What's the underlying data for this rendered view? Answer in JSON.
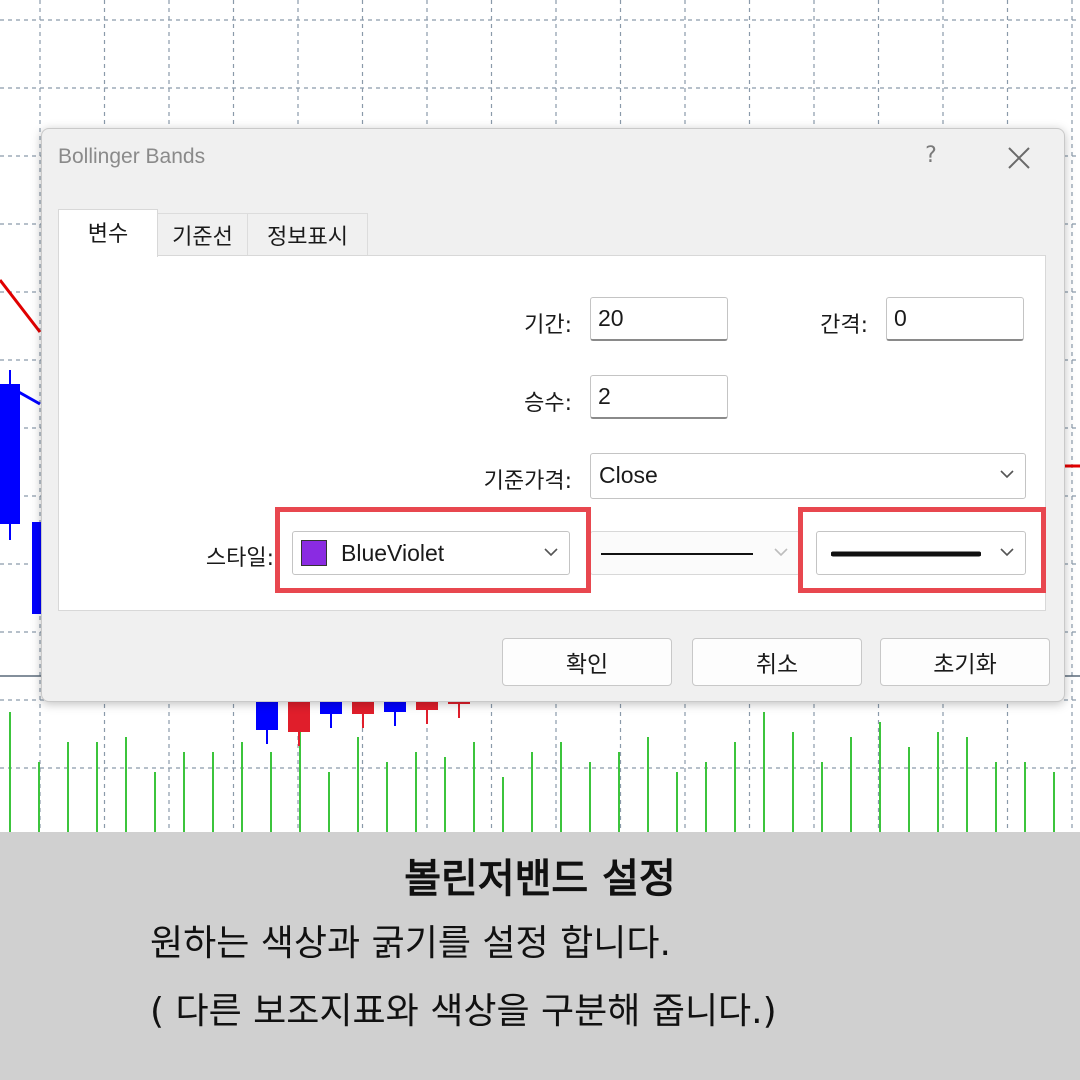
{
  "dialog": {
    "title": "Bollinger Bands",
    "help_label": "?",
    "tabs": [
      {
        "label": "변수",
        "active": true
      },
      {
        "label": "기준선",
        "active": false
      },
      {
        "label": "정보표시",
        "active": false
      }
    ],
    "params": {
      "period_label": "기간:",
      "period_value": "20",
      "shift_label": "간격:",
      "shift_value": "0",
      "deviation_label": "승수:",
      "deviation_value": "2",
      "apply_to_label": "기준가격:",
      "apply_to_value": "Close",
      "style_label": "스타일:",
      "color_name": "BlueViolet",
      "color_hex": "#8a2be2",
      "line_style": "solid",
      "line_width": "thick"
    },
    "buttons": {
      "ok": "확인",
      "cancel": "취소",
      "reset": "초기화"
    },
    "highlight_color": "#e8474f"
  },
  "caption": {
    "title": "볼린저밴드 설정",
    "line1": "원하는 색상과 굵기를 설정 합니다.",
    "line2": "( 다른 보조지표와 색상을 구분해 줍니다.)"
  },
  "chart": {
    "grid": true,
    "bull_color": "#0000ff",
    "bear_color": "#e01e2b",
    "band_color": "#e00000",
    "volume_color": "#3cc43c"
  }
}
